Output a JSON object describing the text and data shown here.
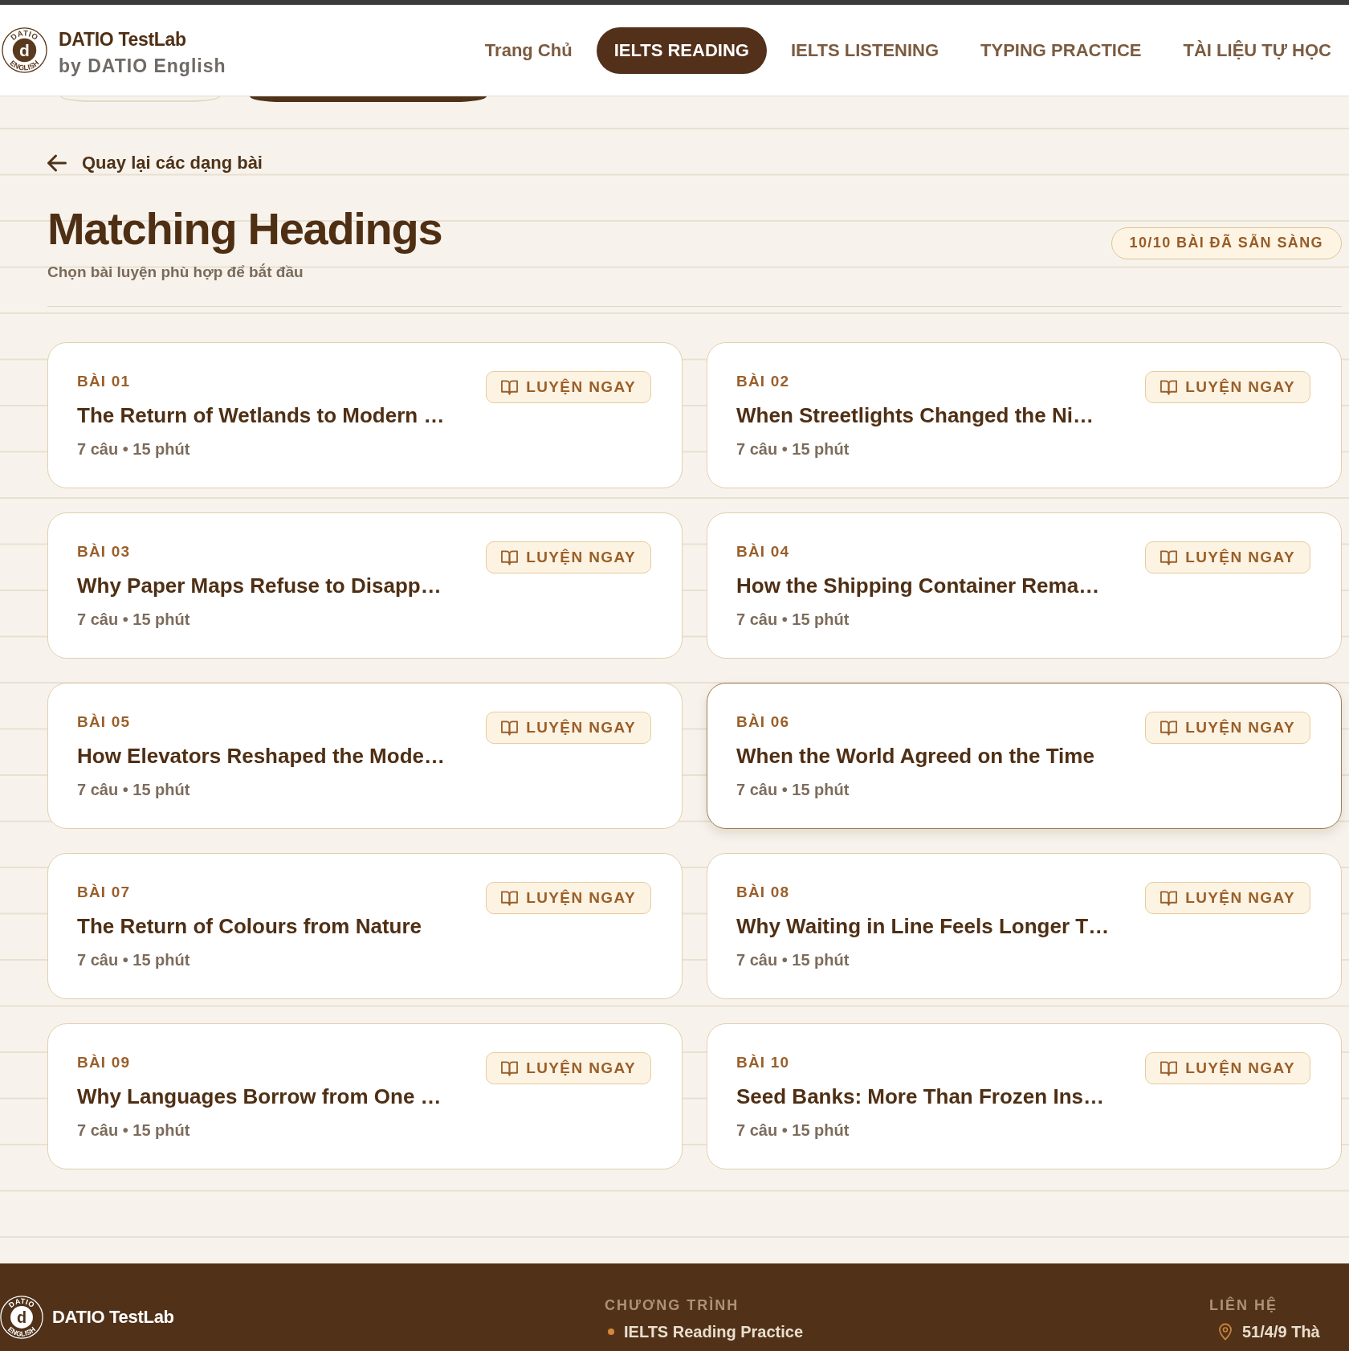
{
  "header": {
    "logo": {
      "top_text": "DATIO",
      "letter": "d",
      "bottom_text": "ENGLISH"
    },
    "brand_name": "DATIO TestLab",
    "brand_tagline": "by DATIO English",
    "nav": [
      {
        "label": "Trang Chủ",
        "selected": false
      },
      {
        "label": "IELTS READING",
        "selected": true
      },
      {
        "label": "IELTS LISTENING",
        "selected": false
      },
      {
        "label": "TYPING PRACTICE",
        "selected": false
      },
      {
        "label": "TÀI LIỆU TỰ HỌC",
        "selected": false
      }
    ]
  },
  "back_link": {
    "label": "Quay lại các dạng bài"
  },
  "page_title": "Matching Headings",
  "subtitle": "Chọn bài luyện phù hợp để bắt đầu",
  "status_badge": "10/10 BÀI ĐÃ SẴN SÀNG",
  "lessons": [
    {
      "number": "BÀI 01",
      "title": "The Return of Wetlands to Modern …",
      "meta": "7 câu • 15 phút",
      "button": "LUYỆN NGAY",
      "hovered": false
    },
    {
      "number": "BÀI 02",
      "title": "When Streetlights Changed the Ni…",
      "meta": "7 câu • 15 phút",
      "button": "LUYỆN NGAY",
      "hovered": false
    },
    {
      "number": "BÀI 03",
      "title": "Why Paper Maps Refuse to Disapp…",
      "meta": "7 câu • 15 phút",
      "button": "LUYỆN NGAY",
      "hovered": false
    },
    {
      "number": "BÀI 04",
      "title": "How the Shipping Container Rema…",
      "meta": "7 câu • 15 phút",
      "button": "LUYỆN NGAY",
      "hovered": false
    },
    {
      "number": "BÀI 05",
      "title": "How Elevators Reshaped the Mode…",
      "meta": "7 câu • 15 phút",
      "button": "LUYỆN NGAY",
      "hovered": false
    },
    {
      "number": "BÀI 06",
      "title": "When the World Agreed on the Time",
      "meta": "7 câu • 15 phút",
      "button": "LUYỆN NGAY",
      "hovered": true
    },
    {
      "number": "BÀI 07",
      "title": "The Return of Colours from Nature",
      "meta": "7 câu • 15 phút",
      "button": "LUYỆN NGAY",
      "hovered": false
    },
    {
      "number": "BÀI 08",
      "title": "Why Waiting in Line Feels Longer T…",
      "meta": "7 câu • 15 phút",
      "button": "LUYỆN NGAY",
      "hovered": false
    },
    {
      "number": "BÀI 09",
      "title": "Why Languages Borrow from One …",
      "meta": "7 câu • 15 phút",
      "button": "LUYỆN NGAY",
      "hovered": false
    },
    {
      "number": "BÀI 10",
      "title": "Seed Banks: More Than Frozen Ins…",
      "meta": "7 câu • 15 phút",
      "button": "LUYỆN NGAY",
      "hovered": false
    }
  ],
  "footer": {
    "logo": {
      "top_text": "DATIO",
      "letter": "d",
      "bottom_text": "ENGLISH"
    },
    "brand_name": "DATIO TestLab",
    "columns": [
      {
        "heading": "CHƯƠNG TRÌNH",
        "items": [
          {
            "kind": "bullet",
            "text": "IELTS Reading Practice"
          }
        ]
      },
      {
        "heading": "LIÊN HỆ",
        "items": [
          {
            "kind": "location",
            "text": "51/4/9 Thà"
          }
        ]
      }
    ]
  }
}
